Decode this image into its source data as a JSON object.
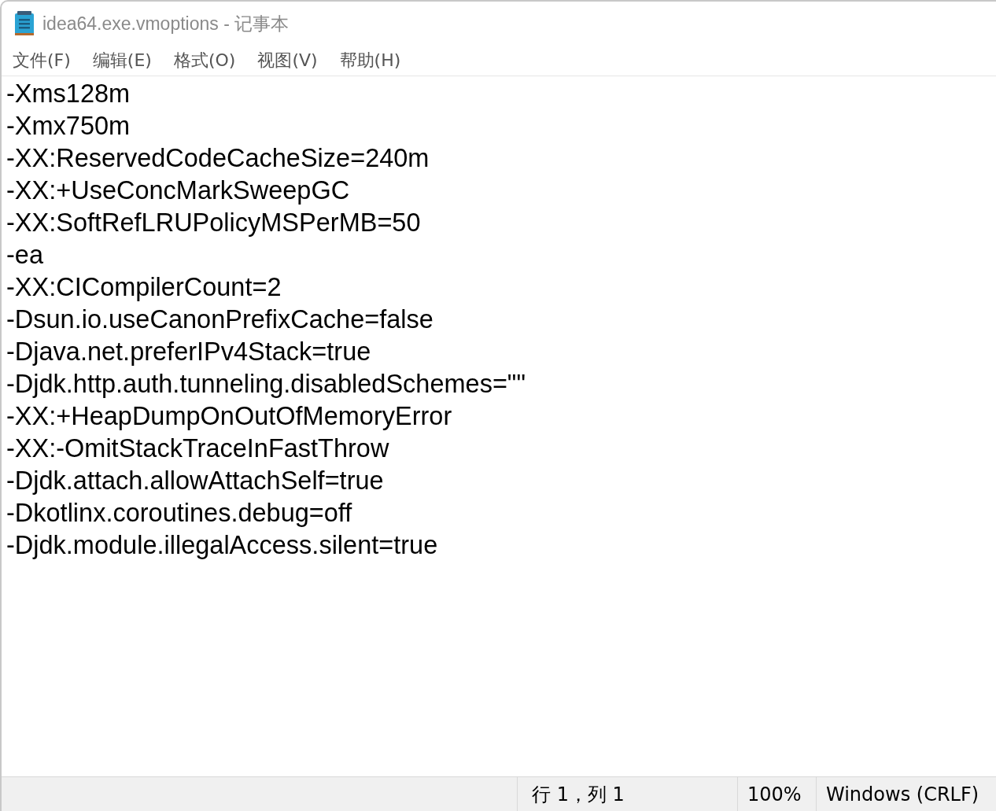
{
  "window": {
    "title": "idea64.exe.vmoptions - 记事本"
  },
  "menu": [
    "文件(F)",
    "编辑(E)",
    "格式(O)",
    "视图(V)",
    "帮助(H)"
  ],
  "editor": {
    "lines": [
      "-Xms128m",
      "-Xmx750m",
      "-XX:ReservedCodeCacheSize=240m",
      "-XX:+UseConcMarkSweepGC",
      "-XX:SoftRefLRUPolicyMSPerMB=50",
      "-ea",
      "-XX:CICompilerCount=2",
      "-Dsun.io.useCanonPrefixCache=false",
      "-Djava.net.preferIPv4Stack=true",
      "-Djdk.http.auth.tunneling.disabledSchemes=\"\"",
      "-XX:+HeapDumpOnOutOfMemoryError",
      "-XX:-OmitStackTraceInFastThrow",
      "-Djdk.attach.allowAttachSelf=true",
      "-Dkotlinx.coroutines.debug=off",
      "-Djdk.module.illegalAccess.silent=true"
    ]
  },
  "status_bar": {
    "position": "行 1，列 1",
    "zoom": "100%",
    "line_ending": "Windows (CRLF)"
  }
}
